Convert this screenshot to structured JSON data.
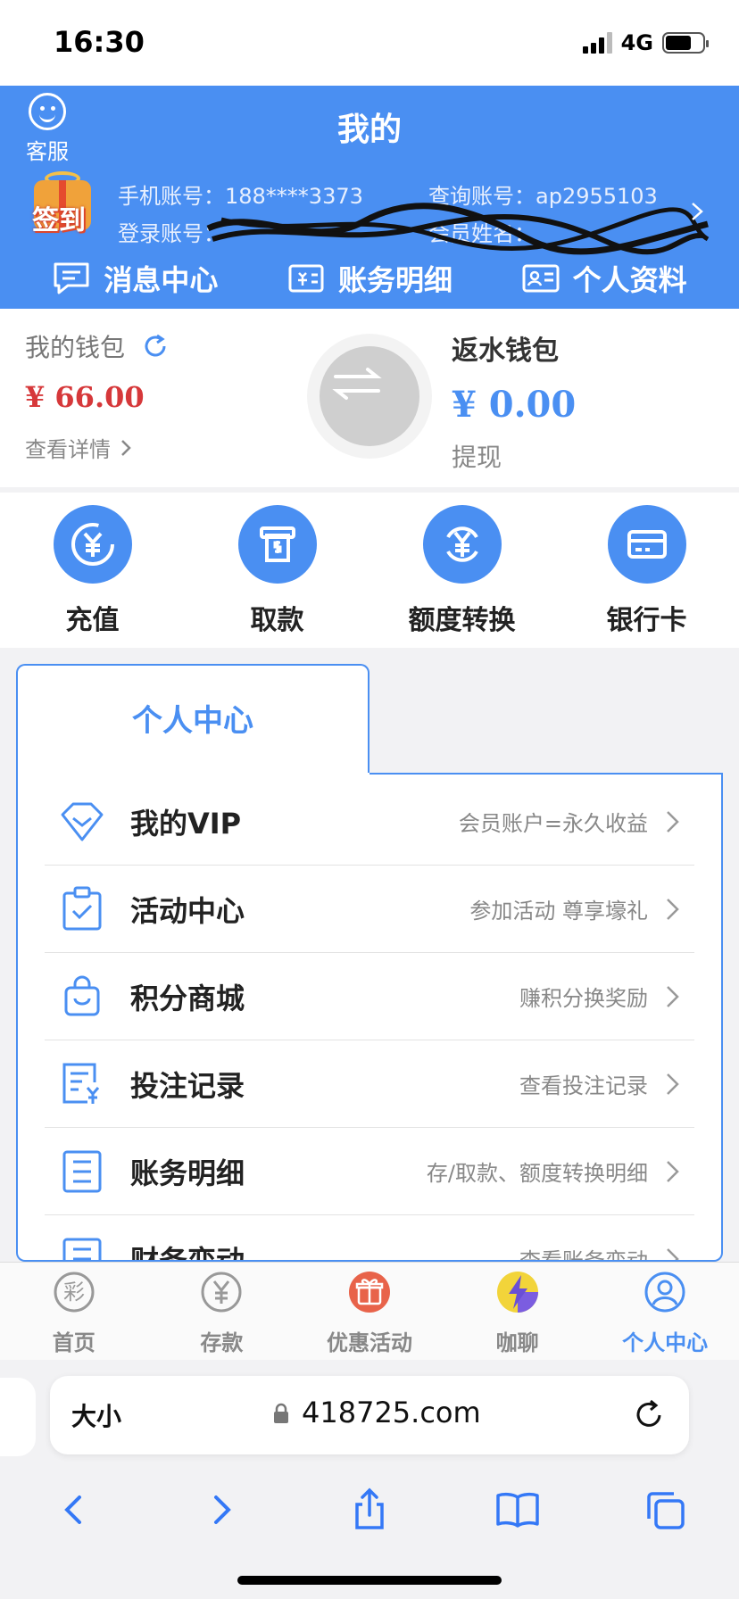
{
  "status_bar": {
    "time": "16:30",
    "network": "4G"
  },
  "header": {
    "customer_service": "客服",
    "title": "我的",
    "sign_in": "签到",
    "phone_account": "手机账号：188****3373",
    "query_account": "查询账号：ap2955103",
    "login_account": "登录账号：",
    "member_name": "会员姓名：",
    "quick_nav": [
      "消息中心",
      "账务明细",
      "个人资料"
    ]
  },
  "wallet": {
    "my_wallet": "我的钱包",
    "balance": "¥ 66.00",
    "view_details": "查看详情",
    "rebate_wallet": "返水钱包",
    "rebate_balance": "¥ 0.00",
    "withdraw": "提现"
  },
  "actions": [
    "充值",
    "取款",
    "额度转换",
    "银行卡"
  ],
  "personal_center": {
    "tab_label": "个人中心",
    "items": [
      {
        "name": "我的VIP",
        "desc": "会员账户=永久收益"
      },
      {
        "name": "活动中心",
        "desc": "参加活动 尊享壕礼"
      },
      {
        "name": "积分商城",
        "desc": "赚积分换奖励"
      },
      {
        "name": "投注记录",
        "desc": "查看投注记录"
      },
      {
        "name": "账务明细",
        "desc": "存/取款、额度转换明细"
      },
      {
        "name": "财务变动",
        "desc": "查看账务变动"
      }
    ]
  },
  "tabbar": [
    {
      "label": "首页",
      "icon": "lottery-icon"
    },
    {
      "label": "存款",
      "icon": "yuan-coin-icon"
    },
    {
      "label": "优惠活动",
      "icon": "gift-icon"
    },
    {
      "label": "咖聊",
      "icon": "lightning-icon"
    },
    {
      "label": "个人中心",
      "icon": "user-icon",
      "active": true
    }
  ],
  "browser": {
    "text_size": "大小",
    "url": "418725.com"
  },
  "colors": {
    "primary": "#4a8ff2",
    "balance_red": "#d6383a"
  }
}
